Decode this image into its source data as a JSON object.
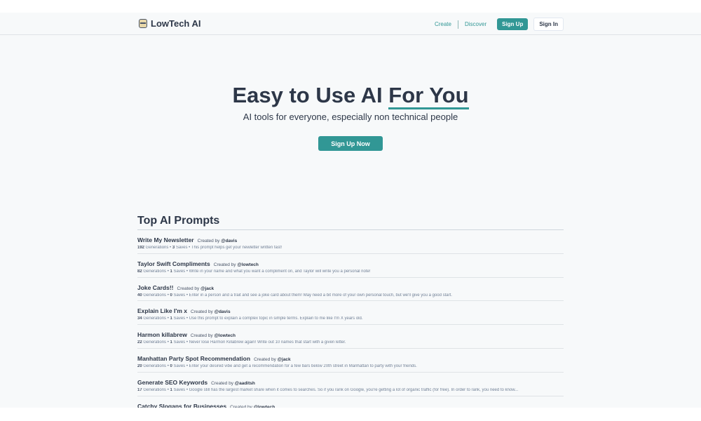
{
  "header": {
    "brand": "LowTech AI",
    "nav": {
      "create": "Create",
      "discover": "Discover",
      "sign_up": "Sign Up",
      "sign_in": "Sign In"
    }
  },
  "hero": {
    "title_main": "Easy to Use AI ",
    "title_highlight": "For You",
    "subtitle": "AI tools for everyone, especially non technical people",
    "cta": "Sign Up Now"
  },
  "prompts_section": {
    "title": "Top AI Prompts",
    "created_by_label": "Created by",
    "generations_label": "Generations",
    "saves_label": "Saves",
    "items": [
      {
        "title": "Write My Newsletter",
        "author": "@davis",
        "generations": "192",
        "saves": "3",
        "description": "This prompt helps get your newletter written fast!"
      },
      {
        "title": "Taylor Swift Compliments",
        "author": "@lowtech",
        "generations": "82",
        "saves": "1",
        "description": "Write in your name and what you want a compliment on, and Taylor will write you a personal note!"
      },
      {
        "title": "Joke Cards!!",
        "author": "@jack",
        "generations": "40",
        "saves": "0",
        "description": "Enter in a person and a trait and see a joke card about them! May need a bit more of your own personal touch, but we'll give you a good start."
      },
      {
        "title": "Explain Like I'm x",
        "author": "@davis",
        "generations": "34",
        "saves": "1",
        "description": "Use this prompt to explain a complex topic in simple terms. Explain to me like I'm X years old."
      },
      {
        "title": "Harmon killabrew",
        "author": "@lowtech",
        "generations": "22",
        "saves": "1",
        "description": "Never lose Harmon Killabrew again! Write out 10 names that start with a given letter."
      },
      {
        "title": "Manhattan Party Spot Recommendation",
        "author": "@jack",
        "generations": "20",
        "saves": "0",
        "description": "Enter your desired vibe and get a recommendation for a few bars below 20th street in Manhattan to party with your friends."
      },
      {
        "title": "Generate SEO Keywords",
        "author": "@aaditsh",
        "generations": "17",
        "saves": "1",
        "description": "Google still has the largest market share when it comes to searches. So if you rank on Google, you're getting a lot of organic traffic (for free). In order to rank, you need to know..."
      },
      {
        "title": "Catchy Slogans for Businesses",
        "author": "@lowtech",
        "generations": "",
        "saves": "",
        "description": ""
      }
    ]
  }
}
